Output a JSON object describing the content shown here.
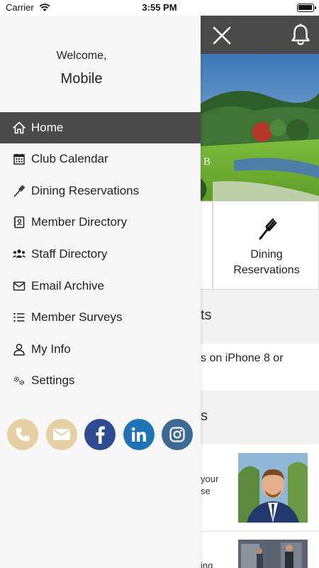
{
  "status_bar": {
    "carrier": "Carrier",
    "time": "3:55 PM",
    "battery_level": 1.0
  },
  "header": {
    "close_icon": "close-icon",
    "bell_icon": "bell-icon",
    "background_color": "#4a4a4a"
  },
  "hero": {
    "letter": "B"
  },
  "tiles": {
    "dining": {
      "icon": "fork-icon",
      "label": "Dining\nReservations"
    }
  },
  "sections": [
    {
      "title": "ts"
    },
    {
      "title": "s"
    }
  ],
  "news": {
    "first_text": "s on iPhone 8 or",
    "items": [
      {
        "text": "your\nse"
      },
      {
        "text": "ing"
      }
    ]
  },
  "drawer": {
    "welcome": "Welcome,",
    "user_name": "Mobile",
    "menu": [
      {
        "label": "Home",
        "icon": "home-icon",
        "active": true
      },
      {
        "label": "Club Calendar",
        "icon": "calendar-icon",
        "active": false
      },
      {
        "label": "Dining Reservations",
        "icon": "fork-icon",
        "active": false
      },
      {
        "label": "Member Directory",
        "icon": "contact-book-icon",
        "active": false
      },
      {
        "label": "Staff Directory",
        "icon": "group-icon",
        "active": false
      },
      {
        "label": "Email Archive",
        "icon": "envelope-icon",
        "active": false
      },
      {
        "label": "Member Surveys",
        "icon": "list-icon",
        "active": false
      },
      {
        "label": "My Info",
        "icon": "user-icon",
        "active": false
      },
      {
        "label": "Settings",
        "icon": "gears-icon",
        "active": false
      }
    ],
    "socials": [
      {
        "icon": "phone-icon",
        "color": "#e6cfa3"
      },
      {
        "icon": "mail-icon",
        "color": "#e6cfa3"
      },
      {
        "icon": "facebook-icon",
        "color": "#2f4c93"
      },
      {
        "icon": "linkedin-icon",
        "color": "#1f72b4"
      },
      {
        "icon": "instagram-icon",
        "color": "#3b6a95"
      }
    ],
    "active_color": "#4a4a4a"
  }
}
